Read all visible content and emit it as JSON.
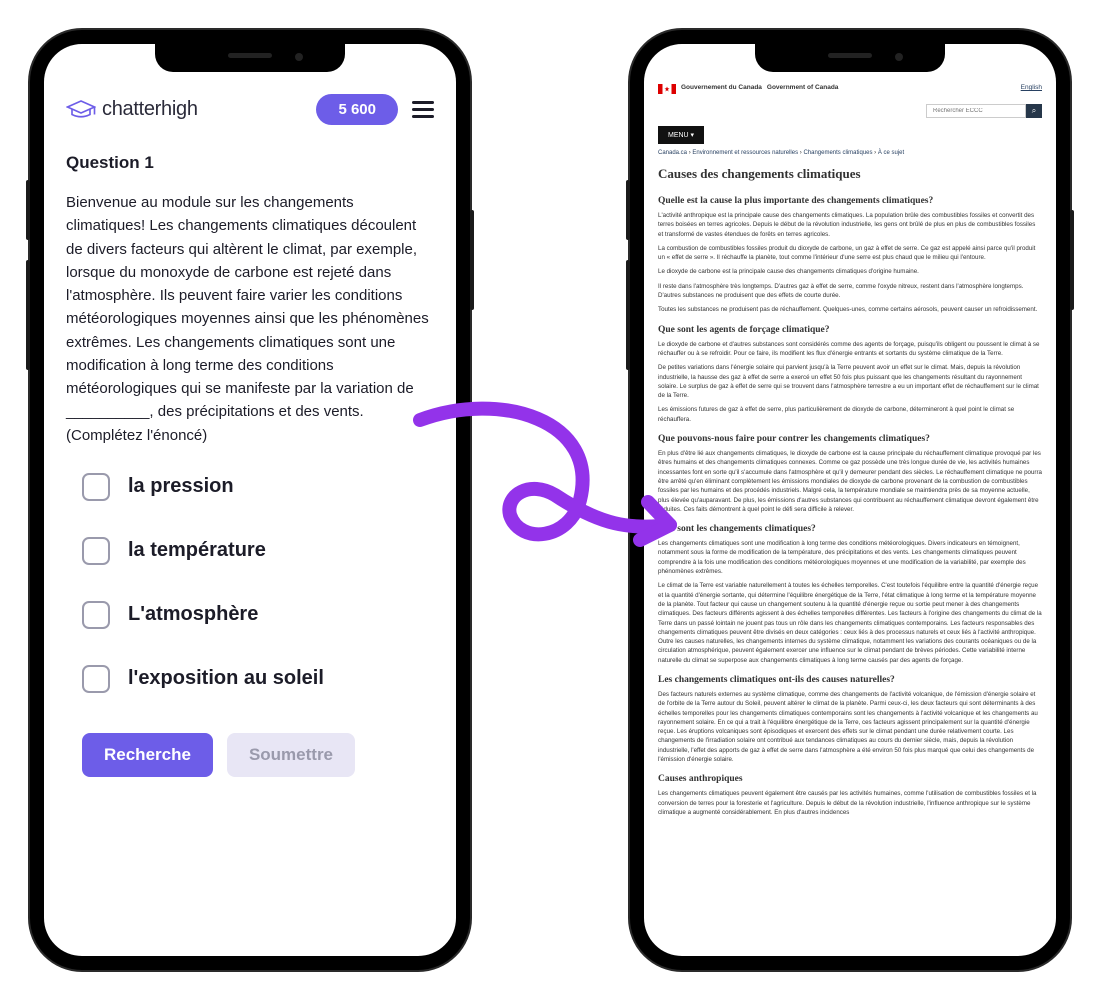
{
  "left": {
    "brand": "chatterhigh",
    "points": "5 600",
    "question_label": "Question 1",
    "question_text": "Bienvenue au module sur les changements climatiques! Les changements climatiques découlent de divers facteurs qui altèrent le climat, par exemple, lorsque du monoxyde de carbone est rejeté dans l'atmosphère. Ils peuvent faire varier les conditions météorologiques moyennes ainsi que les phénomènes extrêmes. Les changements climatiques sont une modification à long terme des conditions météorologiques qui se manifeste par la variation de __________, des précipitations et des vents. (Complétez l'énoncé)",
    "options": [
      "la pression",
      "la température",
      "L'atmosphère",
      "l'exposition au soleil"
    ],
    "btn_research": "Recherche",
    "btn_submit": "Soumettre"
  },
  "right": {
    "gov_fr": "Gouvernement du Canada",
    "gov_en": "Government of Canada",
    "lang": "English",
    "search_placeholder": "Rechercher ECCC",
    "menu": "MENU ▾",
    "breadcrumb": {
      "home": "Canada.ca",
      "l1": "Environnement et ressources naturelles",
      "l2": "Changements climatiques",
      "l3": "À ce sujet"
    },
    "page_title": "Causes des changements climatiques",
    "sections": [
      {
        "h": "Quelle est la cause la plus importante des changements climatiques?",
        "p": [
          "L'activité anthropique est la principale cause des changements climatiques. La population brûle des combustibles fossiles et convertit des terres boisées en terres agricoles. Depuis le début de la révolution industrielle, les gens ont brûlé de plus en plus de combustibles fossiles et transformé de vastes étendues de forêts en terres agricoles.",
          "La combustion de combustibles fossiles produit du dioxyde de carbone, un gaz à effet de serre. Ce gaz est appelé ainsi parce qu'il produit un « effet de serre ». Il réchauffe la planète, tout comme l'intérieur d'une serre est plus chaud que le milieu qui l'entoure.",
          "Le dioxyde de carbone est la principale cause des changements climatiques d'origine humaine.",
          "Il reste dans l'atmosphère très longtemps. D'autres gaz à effet de serre, comme l'oxyde nitreux, restent dans l'atmosphère longtemps. D'autres substances ne produisent que des effets de courte durée.",
          "Toutes les substances ne produisent pas de réchauffement. Quelques-unes, comme certains aérosols, peuvent causer un refroidissement."
        ]
      },
      {
        "h": "Que sont les agents de forçage climatique?",
        "p": [
          "Le dioxyde de carbone et d'autres substances sont considérés comme des agents de forçage, puisqu'ils obligent ou poussent le climat à se réchauffer ou à se refroidir. Pour ce faire, ils modifient les flux d'énergie entrants et sortants du système climatique de la Terre.",
          "De petites variations dans l'énergie solaire qui parvient jusqu'à la Terre peuvent avoir un effet sur le climat. Mais, depuis la révolution industrielle, la hausse des gaz à effet de serre a exercé un effet 50 fois plus puissant que les changements résultant du rayonnement solaire. Le surplus de gaz à effet de serre qui se trouvent dans l'atmosphère terrestre a eu un important effet de réchauffement sur le climat de la Terre.",
          "Les émissions futures de gaz à effet de serre, plus particulièrement de dioxyde de carbone, détermineront à quel point le climat se réchauffera."
        ]
      },
      {
        "h": "Que pouvons-nous faire pour contrer les changements climatiques?",
        "p": [
          "En plus d'être lié aux changements climatiques, le dioxyde de carbone est la cause principale du réchauffement climatique provoqué par les êtres humains et des changements climatiques connexes. Comme ce gaz possède une très longue durée de vie, les activités humaines incessantes font en sorte qu'il s'accumule dans l'atmosphère et qu'il y demeurer pendant des siècles. Le réchauffement climatique ne pourra être arrêté qu'en éliminant complètement les émissions mondiales de dioxyde de carbone provenant de la combustion de combustibles fossiles par les humains et des procédés industriels. Malgré cela, la température mondiale se maintiendra près de sa moyenne actuelle, plus élevée qu'auparavant. De plus, les émissions d'autres substances qui contribuent au réchauffement climatique devront également être réduites. Ces faits démontrent à quel point le défi sera difficile à relever."
        ]
      },
      {
        "h": "Que sont les changements climatiques?",
        "p": [
          "Les changements climatiques sont une modification à long terme des conditions météorologiques. Divers indicateurs en témoignent, notamment sous la forme de modification de la température, des précipitations et des vents. Les changements climatiques peuvent comprendre à la fois une modification des conditions météorologiques moyennes et une modification de la variabilité, par exemple des phénomènes extrêmes.",
          "Le climat de la Terre est variable naturellement à toutes les échelles temporelles. C'est toutefois l'équilibre entre la quantité d'énergie reçue et la quantité d'énergie sortante, qui détermine l'équilibre énergétique de la Terre, l'état climatique à long terme et la température moyenne de la planète. Tout facteur qui cause un changement soutenu à la quantité d'énergie reçue ou sortie peut mener à des changements climatiques. Des facteurs différents agissent à des échelles temporelles différentes. Les facteurs à l'origine des changements du climat de la Terre dans un passé lointain ne jouent pas tous un rôle dans les changements climatiques contemporains. Les facteurs responsables des changements climatiques peuvent être divisés en deux catégories : ceux liés à des processus naturels et ceux liés à l'activité anthropique. Outre les causes naturelles, les changements internes du système climatique, notamment les variations des courants océaniques ou de la circulation atmosphérique, peuvent également exercer une influence sur le climat pendant de brèves périodes. Cette variabilité interne naturelle du climat se superpose aux changements climatiques à long terme causés par des agents de forçage."
        ]
      },
      {
        "h": "Les changements climatiques ont-ils des causes naturelles?",
        "p": [
          "Des facteurs naturels externes au système climatique, comme des changements de l'activité volcanique, de l'émission d'énergie solaire et de l'orbite de la Terre autour du Soleil, peuvent altérer le climat de la planète. Parmi ceux-ci, les deux facteurs qui sont déterminants à des échelles temporelles pour les changements climatiques contemporains sont les changements à l'activité volcanique et les changements au rayonnement solaire. En ce qui a trait à l'équilibre énergétique de la Terre, ces facteurs agissent principalement sur la quantité d'énergie reçue. Les éruptions volcaniques sont épisodiques et exercent des effets sur le climat pendant une durée relativement courte. Les changements de l'irradiation solaire ont contribué aux tendances climatiques au cours du dernier siècle, mais, depuis la révolution industrielle, l'effet des apports de gaz à effet de serre dans l'atmosphère a été environ 50 fois plus marqué que celui des changements de l'émission d'énergie solaire."
        ]
      },
      {
        "h": "Causes anthropiques",
        "p": [
          "Les changements climatiques peuvent également être causés par les activités humaines, comme l'utilisation de combustibles fossiles et la conversion de terres pour la foresterie et l'agriculture. Depuis le début de la révolution industrielle, l'influence anthropique sur le système climatique a augmenté considérablement. En plus d'autres incidences"
        ]
      }
    ]
  }
}
